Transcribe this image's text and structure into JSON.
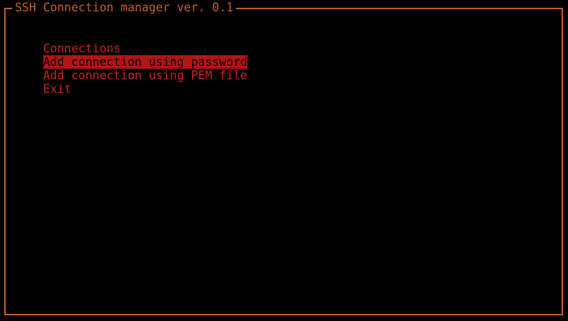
{
  "window": {
    "title": "SSH Connection manager ver. 0.1"
  },
  "menu": {
    "items": [
      {
        "label": "Connections",
        "selected": false
      },
      {
        "label": "Add connection using password",
        "selected": true
      },
      {
        "label": "Add connection using PEM file",
        "selected": false
      },
      {
        "label": "Exit",
        "selected": false
      }
    ]
  },
  "colors": {
    "border": "#c0622a",
    "text": "#c8231e",
    "highlight": "#b41414",
    "background": "#000000"
  }
}
